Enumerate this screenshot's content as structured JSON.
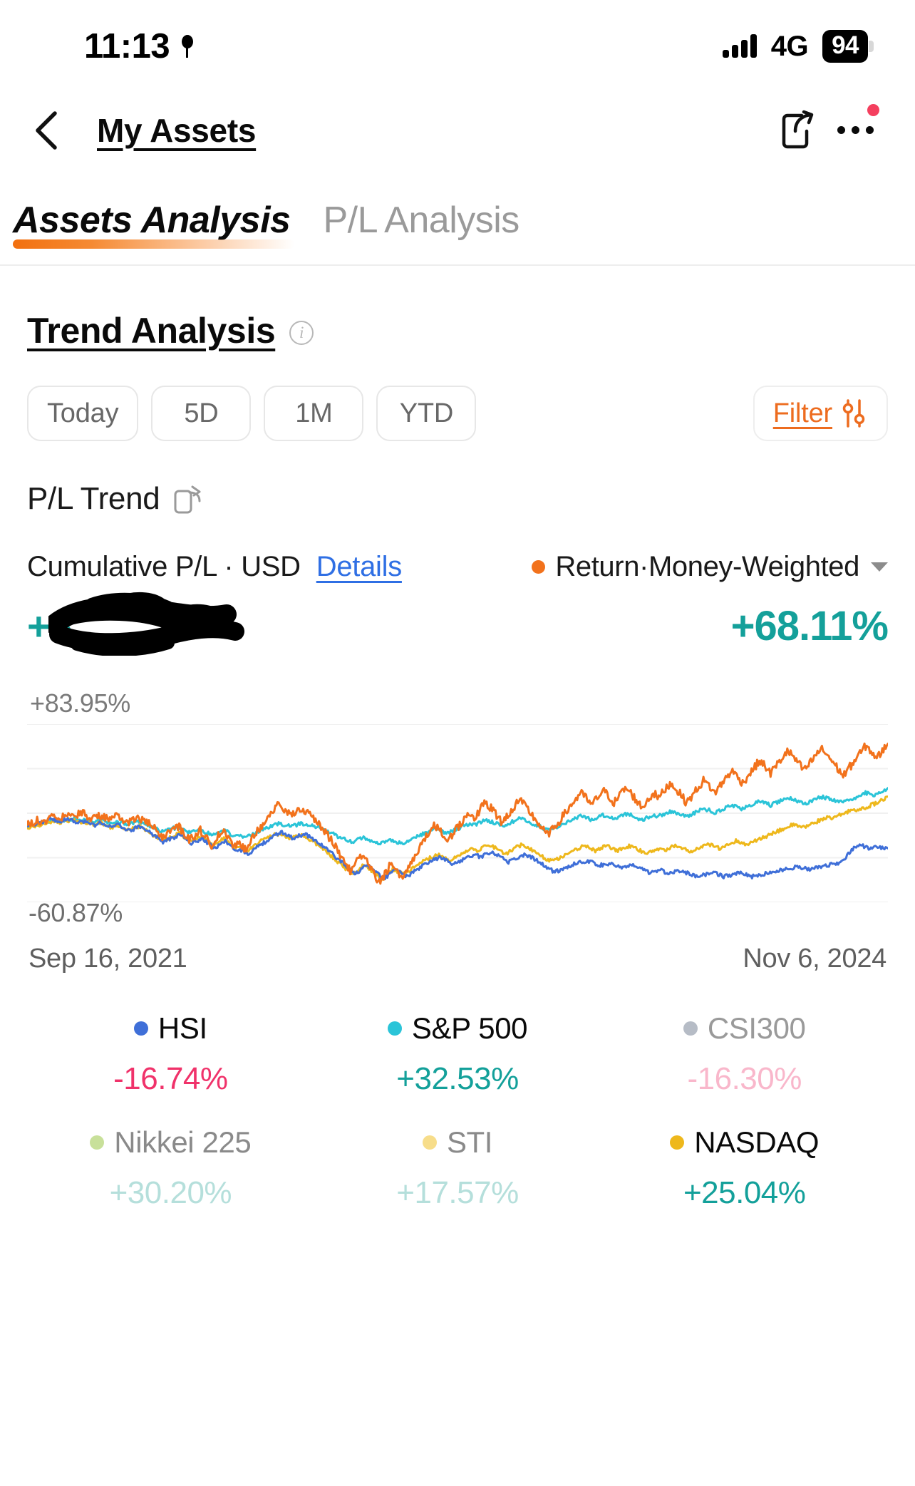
{
  "status_bar": {
    "time": "11:13",
    "location_icon": "location-pin-icon",
    "signal_icon": "signal-bars-icon",
    "network": "4G",
    "battery_level": "94"
  },
  "nav": {
    "back_icon": "chevron-left-icon",
    "title": "My Assets",
    "share_icon": "share-icon",
    "more_icon": "more-horizontal-icon",
    "badge_color": "#f43f5e"
  },
  "tabs": [
    {
      "label": "Assets Analysis",
      "active": true
    },
    {
      "label": "P/L Analysis",
      "active": false
    }
  ],
  "section": {
    "title": "Trend Analysis",
    "info_icon": "info-circle-icon"
  },
  "range_chips": [
    {
      "label": "Today"
    },
    {
      "label": "5D"
    },
    {
      "label": "1M"
    },
    {
      "label": "YTD"
    }
  ],
  "filter": {
    "label": "Filter",
    "icon": "sliders-icon",
    "color": "#ed6c1f"
  },
  "pl_trend": {
    "label": "P/L Trend",
    "rotate_icon": "rotate-screen-icon"
  },
  "cumulative": {
    "label": "Cumulative P/L · USD",
    "details_link": "Details",
    "return_metric": "Return·Money-Weighted",
    "metric_dot_color": "#f2721c",
    "dropdown_icon": "chevron-down-icon",
    "amount_value": "+$",
    "amount_redacted": true,
    "return_value": "+68.11%",
    "positive_color": "#14a09a"
  },
  "chart_data": {
    "type": "line",
    "title": "Cumulative P/L · USD",
    "xlabel": "",
    "ylabel": "",
    "ylim": [
      -60.87,
      83.95
    ],
    "y_axis_top_label": "+83.95%",
    "y_axis_bottom_label": "-60.87%",
    "x_start": "Sep 16, 2021",
    "x_end": "Nov 6, 2024",
    "grid": true,
    "legend_position": "below",
    "series": [
      {
        "name": "Return·Money-Weighted",
        "color": "#f2721c",
        "final_value": 68.11,
        "visible": true,
        "values": [
          2,
          4,
          6,
          5,
          8,
          10,
          8,
          11,
          13,
          10,
          12,
          9,
          7,
          10,
          8,
          6,
          9,
          7,
          4,
          6,
          8,
          5,
          2,
          -2,
          -8,
          -5,
          -2,
          1,
          -4,
          -10,
          -6,
          -2,
          -9,
          -14,
          -8,
          -3,
          -9,
          -16,
          -12,
          -18,
          -10,
          -4,
          2,
          8,
          14,
          18,
          14,
          10,
          13,
          16,
          12,
          8,
          4,
          -2,
          -8,
          -14,
          -22,
          -30,
          -36,
          -28,
          -22,
          -30,
          -38,
          -45,
          -38,
          -30,
          -36,
          -42,
          -34,
          -26,
          -18,
          -10,
          -4,
          2,
          -4,
          -10,
          -6,
          0,
          6,
          12,
          8,
          14,
          20,
          16,
          10,
          4,
          10,
          16,
          22,
          18,
          12,
          6,
          0,
          -6,
          -2,
          4,
          10,
          16,
          22,
          28,
          24,
          18,
          24,
          30,
          26,
          20,
          26,
          32,
          28,
          22,
          16,
          22,
          28,
          24,
          30,
          36,
          32,
          26,
          20,
          26,
          32,
          38,
          34,
          28,
          34,
          40,
          46,
          42,
          36,
          42,
          48,
          54,
          50,
          44,
          50,
          56,
          62,
          58,
          52,
          46,
          52,
          58,
          64,
          60,
          54,
          48,
          42,
          48,
          54,
          60,
          66,
          62,
          56,
          62,
          68
        ]
      },
      {
        "name": "S&P 500",
        "color": "#2bc4d8",
        "final_value": 32.53,
        "visible": true,
        "values": [
          1,
          2,
          3,
          4,
          5,
          6,
          5,
          6,
          7,
          6,
          7,
          6,
          5,
          6,
          5,
          4,
          5,
          4,
          3,
          4,
          5,
          3,
          1,
          -1,
          -3,
          -2,
          -1,
          0,
          -2,
          -4,
          -3,
          -2,
          -4,
          -6,
          -4,
          -2,
          -4,
          -7,
          -6,
          -8,
          -6,
          -4,
          -2,
          0,
          2,
          3,
          2,
          1,
          2,
          3,
          2,
          1,
          0,
          -2,
          -4,
          -6,
          -8,
          -10,
          -12,
          -10,
          -8,
          -10,
          -12,
          -14,
          -12,
          -10,
          -12,
          -13,
          -11,
          -9,
          -7,
          -5,
          -3,
          -1,
          -3,
          -5,
          -3,
          -1,
          1,
          3,
          2,
          4,
          6,
          5,
          3,
          1,
          3,
          5,
          7,
          6,
          4,
          2,
          0,
          -2,
          -1,
          1,
          3,
          5,
          7,
          9,
          8,
          6,
          8,
          10,
          9,
          7,
          9,
          11,
          10,
          8,
          6,
          8,
          10,
          9,
          11,
          13,
          12,
          10,
          9,
          11,
          13,
          15,
          14,
          12,
          14,
          16,
          18,
          17,
          15,
          17,
          19,
          21,
          20,
          18,
          20,
          22,
          24,
          23,
          21,
          19,
          21,
          23,
          25,
          24,
          22,
          21,
          20,
          22,
          24,
          26,
          28,
          27,
          26,
          29,
          32
        ]
      },
      {
        "name": "HSI",
        "color": "#3f6fd8",
        "final_value": -16.74,
        "visible": true,
        "values": [
          1,
          2,
          3,
          5,
          7,
          6,
          5,
          7,
          6,
          4,
          5,
          3,
          2,
          4,
          2,
          0,
          2,
          0,
          -3,
          -1,
          1,
          -2,
          -5,
          -8,
          -12,
          -10,
          -8,
          -6,
          -9,
          -13,
          -11,
          -9,
          -13,
          -17,
          -14,
          -11,
          -15,
          -20,
          -18,
          -22,
          -18,
          -15,
          -12,
          -9,
          -6,
          -4,
          -6,
          -9,
          -7,
          -5,
          -8,
          -11,
          -14,
          -18,
          -22,
          -26,
          -30,
          -34,
          -38,
          -34,
          -30,
          -34,
          -38,
          -42,
          -38,
          -34,
          -37,
          -40,
          -37,
          -34,
          -31,
          -28,
          -26,
          -24,
          -27,
          -30,
          -28,
          -26,
          -24,
          -22,
          -24,
          -22,
          -20,
          -22,
          -25,
          -28,
          -26,
          -24,
          -22,
          -24,
          -27,
          -30,
          -33,
          -36,
          -35,
          -33,
          -31,
          -29,
          -28,
          -27,
          -29,
          -31,
          -30,
          -29,
          -31,
          -33,
          -32,
          -31,
          -33,
          -35,
          -37,
          -36,
          -35,
          -37,
          -36,
          -35,
          -36,
          -38,
          -40,
          -39,
          -38,
          -37,
          -38,
          -40,
          -39,
          -38,
          -37,
          -38,
          -40,
          -39,
          -38,
          -37,
          -36,
          -35,
          -34,
          -33,
          -32,
          -33,
          -34,
          -33,
          -32,
          -31,
          -30,
          -29,
          -28,
          -22,
          -16,
          -14,
          -16,
          -17,
          -16,
          -17,
          -17
        ]
      },
      {
        "name": "NASDAQ",
        "color": "#eeb81c",
        "final_value": 25.04,
        "visible": true,
        "values": [
          0,
          1,
          2,
          3,
          4,
          5,
          4,
          5,
          6,
          4,
          5,
          3,
          2,
          4,
          2,
          0,
          2,
          0,
          -2,
          -1,
          1,
          -2,
          -5,
          -8,
          -11,
          -9,
          -7,
          -5,
          -8,
          -11,
          -9,
          -7,
          -11,
          -15,
          -12,
          -9,
          -13,
          -17,
          -15,
          -19,
          -16,
          -13,
          -10,
          -8,
          -6,
          -5,
          -7,
          -9,
          -7,
          -6,
          -9,
          -12,
          -15,
          -19,
          -23,
          -27,
          -31,
          -35,
          -38,
          -34,
          -30,
          -34,
          -38,
          -42,
          -38,
          -34,
          -36,
          -38,
          -35,
          -32,
          -29,
          -26,
          -24,
          -22,
          -24,
          -27,
          -25,
          -22,
          -19,
          -17,
          -19,
          -16,
          -14,
          -16,
          -19,
          -22,
          -19,
          -16,
          -14,
          -16,
          -19,
          -22,
          -25,
          -27,
          -26,
          -24,
          -21,
          -19,
          -17,
          -15,
          -17,
          -19,
          -17,
          -15,
          -17,
          -19,
          -17,
          -15,
          -17,
          -19,
          -21,
          -19,
          -17,
          -19,
          -17,
          -15,
          -16,
          -18,
          -20,
          -18,
          -16,
          -14,
          -15,
          -17,
          -15,
          -13,
          -11,
          -12,
          -14,
          -12,
          -10,
          -8,
          -6,
          -4,
          -2,
          0,
          2,
          1,
          0,
          2,
          4,
          6,
          8,
          7,
          9,
          11,
          13,
          15,
          14,
          16,
          18,
          20,
          22,
          25
        ]
      }
    ]
  },
  "legend": {
    "rows": [
      [
        {
          "name": "HSI",
          "value": "-16.74%",
          "dot_color": "#3f6fd8",
          "name_color": "#0a0a0a",
          "value_color": "#f0326a",
          "active": true
        },
        {
          "name": "S&P 500",
          "value": "+32.53%",
          "dot_color": "#2bc4d8",
          "name_color": "#0a0a0a",
          "value_color": "#13a09a",
          "active": true
        },
        {
          "name": "CSI300",
          "value": "-16.30%",
          "dot_color": "#b6bcc6",
          "name_color": "#9a9a9a",
          "value_color": "#f9b7cb",
          "active": false
        }
      ],
      [
        {
          "name": "Nikkei 225",
          "value": "+30.20%",
          "dot_color": "#c8e09a",
          "name_color": "#8a8a8a",
          "value_color": "#b5dfdb",
          "active": false
        },
        {
          "name": "STI",
          "value": "+17.57%",
          "dot_color": "#f7dd8a",
          "name_color": "#8a8a8a",
          "value_color": "#b5dfdb",
          "active": false
        },
        {
          "name": "NASDAQ",
          "value": "+25.04%",
          "dot_color": "#eeb81c",
          "name_color": "#0a0a0a",
          "value_color": "#13a09a",
          "active": true
        }
      ]
    ]
  }
}
